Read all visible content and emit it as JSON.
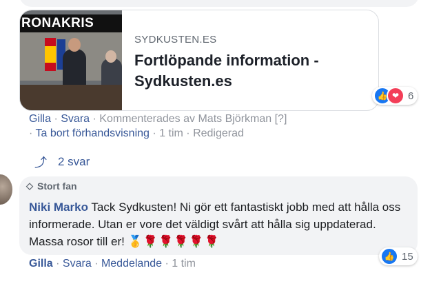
{
  "link_card": {
    "thumbnail_banner": "RONAKRIS",
    "domain": "SYDKUSTEN.ES",
    "title": "Fortlöpande information - Sydkusten.es",
    "reaction_icons": [
      "like-icon",
      "love-icon"
    ],
    "reaction_count": "6"
  },
  "comment1_actions": {
    "like": "Gilla",
    "reply": "Svara",
    "sep": "·",
    "commented_by": "Kommenterades av Mats Björkman",
    "help": "[?]",
    "remove_preview": "Ta bort förhandsvisning",
    "time": "1 tim",
    "edited": "Redigerad"
  },
  "replies": {
    "label": "2 svar"
  },
  "comment2": {
    "badge": "Stort fan",
    "author": "Niki Marko",
    "text": "Tack Sydkusten! Ni gör ett fantastiskt jobb med att hålla oss informerade. Utan er vore det väldigt svårt att hålla sig uppdaterad. Massa rosor till er!",
    "emojis": "🥇🌹🌹🌹🌹🌹",
    "like_count": "15"
  },
  "comment2_actions": {
    "like": "Gilla",
    "reply": "Svara",
    "message": "Meddelande",
    "time": "1 tim"
  },
  "colors": {
    "link": "#385898",
    "meta": "#90949c",
    "like_blue": "#1877f2",
    "love_red": "#f33e58",
    "bubble": "#f2f3f5"
  }
}
